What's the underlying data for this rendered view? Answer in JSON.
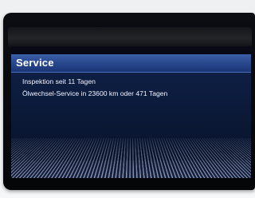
{
  "screen": {
    "header": {
      "title": "Service"
    },
    "messages": [
      {
        "text": "Inspektion seit 11 Tagen"
      },
      {
        "text": "Ölwechsel-Service in 23600 km oder 471 Tagen"
      }
    ]
  },
  "colors": {
    "header_bar": "#2a4a90",
    "content_bg": "#0e1f44",
    "text": "#ffffff"
  }
}
